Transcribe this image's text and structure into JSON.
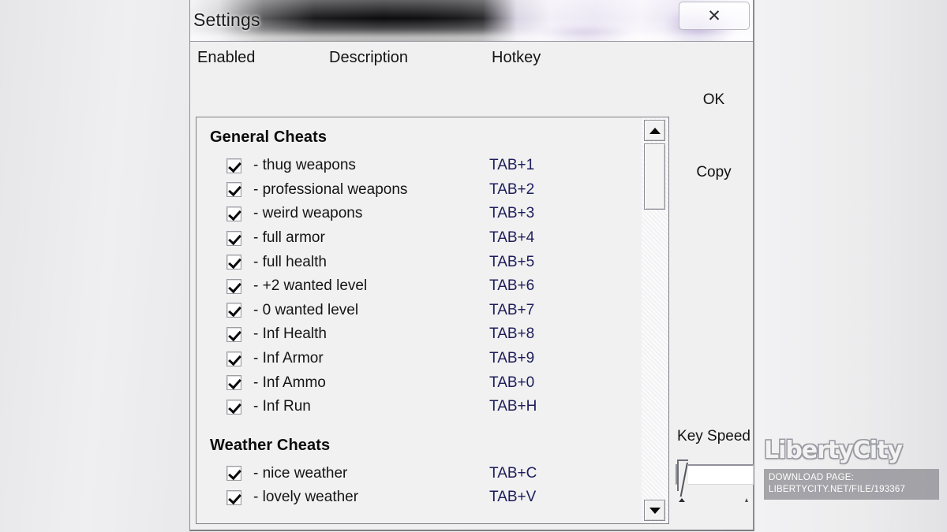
{
  "window": {
    "title": "Settings",
    "close_label": "✕"
  },
  "columns": {
    "enabled": "Enabled",
    "description": "Description",
    "hotkey": "Hotkey"
  },
  "list": {
    "groups": [
      {
        "title": "General Cheats",
        "items": [
          {
            "checked": true,
            "desc": "- thug weapons",
            "hotkey": "TAB+1"
          },
          {
            "checked": true,
            "desc": "- professional weapons",
            "hotkey": "TAB+2"
          },
          {
            "checked": true,
            "desc": "- weird weapons",
            "hotkey": "TAB+3"
          },
          {
            "checked": true,
            "desc": "- full armor",
            "hotkey": "TAB+4"
          },
          {
            "checked": true,
            "desc": "- full health",
            "hotkey": "TAB+5"
          },
          {
            "checked": true,
            "desc": "- +2 wanted level",
            "hotkey": "TAB+6"
          },
          {
            "checked": true,
            "desc": "- 0 wanted level",
            "hotkey": "TAB+7"
          },
          {
            "checked": true,
            "desc": "- Inf Health",
            "hotkey": "TAB+8"
          },
          {
            "checked": true,
            "desc": "- Inf Armor",
            "hotkey": "TAB+9"
          },
          {
            "checked": true,
            "desc": "- Inf Ammo",
            "hotkey": "TAB+0"
          },
          {
            "checked": true,
            "desc": "- Inf Run",
            "hotkey": "TAB+H"
          }
        ]
      },
      {
        "title": "Weather Cheats",
        "items": [
          {
            "checked": true,
            "desc": "- nice weather",
            "hotkey": "TAB+C"
          },
          {
            "checked": true,
            "desc": "- lovely weather",
            "hotkey": "TAB+V"
          }
        ]
      }
    ]
  },
  "side_panel": {
    "ok_label": "OK",
    "copy_label": "Copy",
    "key_speed_label": "Key Speed",
    "key_speed_value": 0
  },
  "scrollbar": {
    "up_arrow": "▲",
    "down_arrow": "▼"
  },
  "watermark": {
    "logo": "LibertyCity",
    "line1": "DOWNLOAD PAGE:",
    "line2": "LIBERTYCITY.NET/FILE/193367"
  },
  "colors": {
    "hotkey": "#1d1d5c",
    "window_bg": "#f0f0f0",
    "list_bg": "#f1f1f1"
  }
}
